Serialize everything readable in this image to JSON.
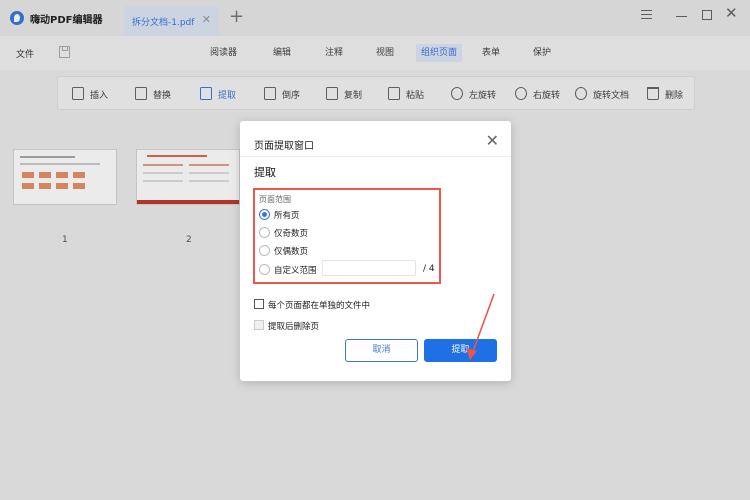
{
  "app": {
    "name": "嗨动PDF编辑器"
  },
  "tab": {
    "name": "拆分文档-1.pdf"
  },
  "menubar": {
    "file_label": "文件",
    "tabs": [
      "阅读器",
      "编辑",
      "注释",
      "视图",
      "组织页面",
      "表单",
      "保护"
    ],
    "active_tab": "组织页面"
  },
  "toolbar": {
    "tools": [
      {
        "label": "插入",
        "icon": "insert-icon"
      },
      {
        "label": "替换",
        "icon": "replace-icon"
      },
      {
        "label": "提取",
        "icon": "extract-icon",
        "active": true
      },
      {
        "label": "倒序",
        "icon": "reverse-icon"
      },
      {
        "label": "复制",
        "icon": "copy-icon"
      },
      {
        "label": "粘贴",
        "icon": "paste-icon"
      },
      {
        "label": "左旋转",
        "icon": "rotate-left-icon"
      },
      {
        "label": "右旋转",
        "icon": "rotate-right-icon"
      },
      {
        "label": "旋转文档",
        "icon": "rotate-document-icon"
      },
      {
        "label": "删除",
        "icon": "delete-icon"
      }
    ],
    "accent_color": "#3a78e0"
  },
  "pages": {
    "thumbnails": [
      {
        "number": "1"
      },
      {
        "number": "2"
      }
    ]
  },
  "dialog": {
    "title": "页面提取窗口",
    "section_title": "提取",
    "range_label": "页面范围",
    "options": [
      "所有页",
      "仅奇数页",
      "仅偶数页",
      "自定义范围"
    ],
    "selected_option": "所有页",
    "custom_range_value": "",
    "page_total": "/ 4",
    "separate_files_label": "每个页面都在单独的文件中",
    "delete_after_label": "提取后删除页",
    "cancel_label": "取消",
    "extract_label": "提取",
    "highlight_color": "#e8584f"
  }
}
